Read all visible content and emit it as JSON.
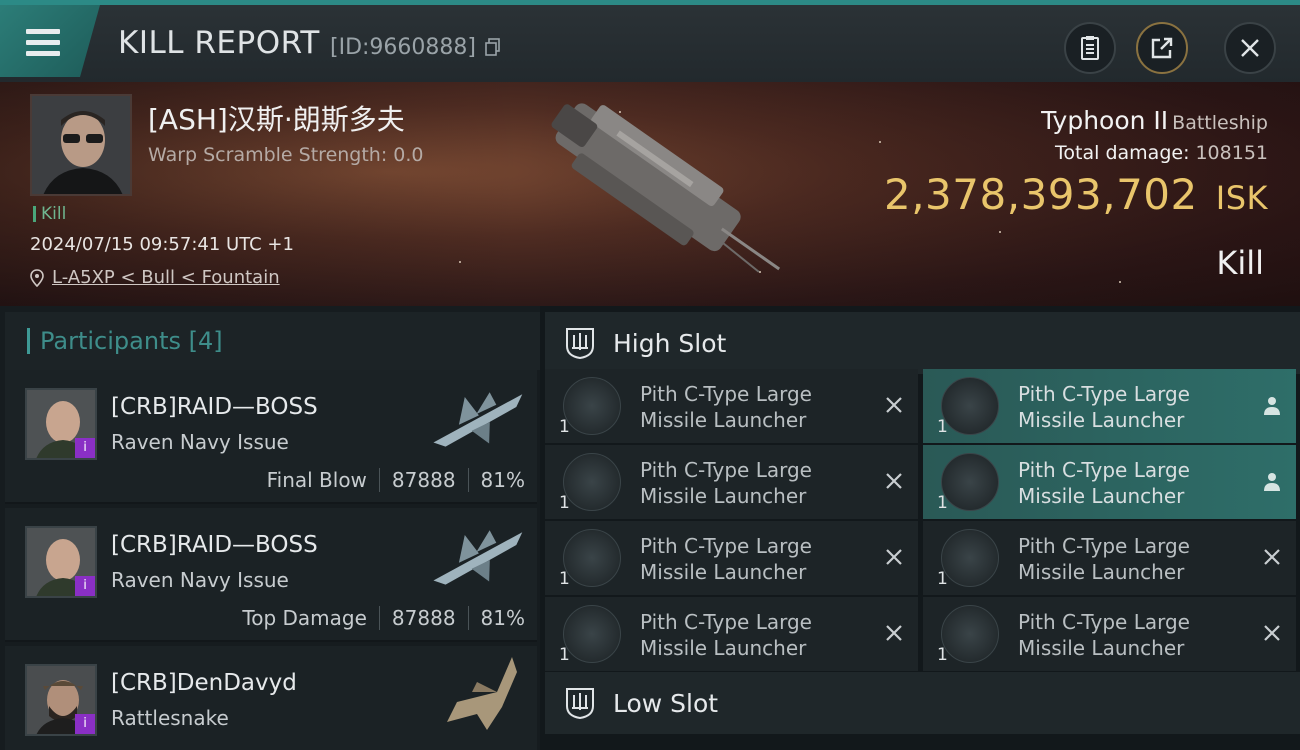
{
  "header": {
    "title": "KILL REPORT",
    "report_id": "[ID:9660888]"
  },
  "victim": {
    "name": "[ASH]汉斯·朗斯多夫",
    "warp_scramble": "Warp Scramble Strength: 0.0",
    "kill_tag": "Kill",
    "timestamp": "2024/07/15 09:57:41 UTC +1",
    "location": "L-A5XP < Bull < Fountain",
    "ship_name": "Typhoon II",
    "ship_class": "Battleship",
    "total_damage_label": "Total damage:",
    "total_damage": "108151",
    "isk_value": "2,378,393,702",
    "isk_unit": "ISK",
    "result": "Kill"
  },
  "participants": {
    "label": "Participants",
    "count": "[4]",
    "rows": [
      {
        "name": "[CRB]RAID—BOSS",
        "ship": "Raven Navy Issue",
        "tag": "Final Blow",
        "damage": "87888",
        "percent": "81%"
      },
      {
        "name": "[CRB]RAID—BOSS",
        "ship": "Raven Navy Issue",
        "tag": "Top Damage",
        "damage": "87888",
        "percent": "81%"
      },
      {
        "name": "[CRB]DenDavyd",
        "ship": "Rattlesnake",
        "tag": "",
        "damage": "",
        "percent": ""
      }
    ]
  },
  "slots": {
    "high_label": "High Slot",
    "low_label": "Low Slot",
    "module_line1": "Pith C-Type Large",
    "module_line2": "Missile Launcher",
    "qty": "1",
    "high_modules": [
      {
        "state": "destroyed"
      },
      {
        "state": "dropped"
      },
      {
        "state": "destroyed"
      },
      {
        "state": "dropped"
      },
      {
        "state": "destroyed"
      },
      {
        "state": "destroyed"
      },
      {
        "state": "destroyed"
      },
      {
        "state": "destroyed"
      }
    ]
  }
}
